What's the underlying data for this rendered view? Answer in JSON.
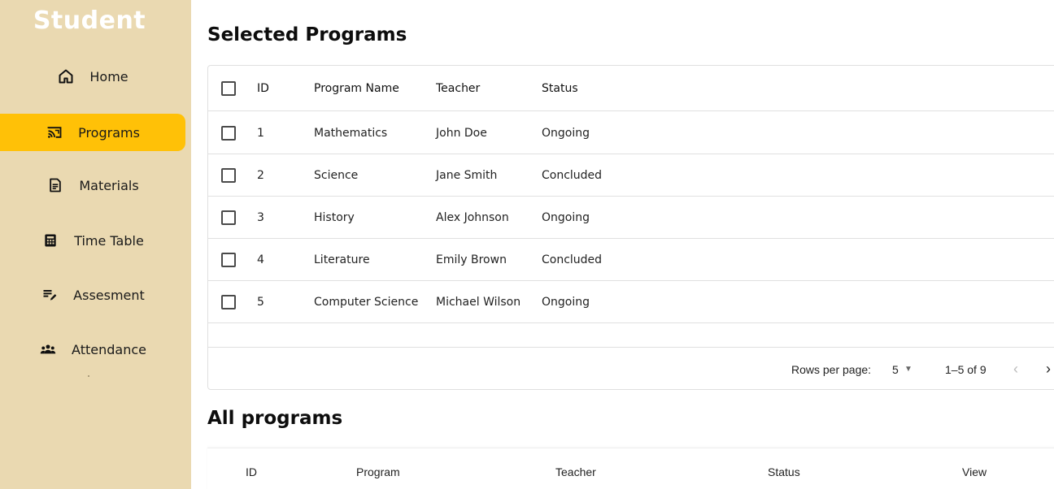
{
  "sidebar": {
    "brand": "Student",
    "items": [
      {
        "label": "Home",
        "icon": "home-icon",
        "active": false
      },
      {
        "label": "Programs",
        "icon": "cast-icon",
        "active": true
      },
      {
        "label": "Materials",
        "icon": "document-icon",
        "active": false
      },
      {
        "label": "Time Table",
        "icon": "calculator-icon",
        "active": false
      },
      {
        "label": "Assesment",
        "icon": "edit-note-icon",
        "active": false
      },
      {
        "label": "Attendance",
        "icon": "group-icon",
        "active": false
      }
    ],
    "active_color": "#ffc107",
    "background": "#ead9b1"
  },
  "selected": {
    "title": "Selected Programs",
    "columns": [
      "ID",
      "Program Name",
      "Teacher",
      "Status"
    ],
    "rows": [
      {
        "id": "1",
        "name": "Mathematics",
        "teacher": "John Doe",
        "status": "Ongoing"
      },
      {
        "id": "2",
        "name": "Science",
        "teacher": "Jane Smith",
        "status": "Concluded"
      },
      {
        "id": "3",
        "name": "History",
        "teacher": "Alex Johnson",
        "status": "Ongoing"
      },
      {
        "id": "4",
        "name": "Literature",
        "teacher": "Emily Brown",
        "status": "Concluded"
      },
      {
        "id": "5",
        "name": "Computer Science",
        "teacher": "Michael Wilson",
        "status": "Ongoing"
      }
    ],
    "pagination": {
      "rows_per_page_label": "Rows per page:",
      "rows_per_page": "5",
      "range": "1–5 of 9"
    }
  },
  "all": {
    "title": "All programs",
    "columns": [
      "ID",
      "Program",
      "Teacher",
      "Status",
      "View"
    ]
  }
}
